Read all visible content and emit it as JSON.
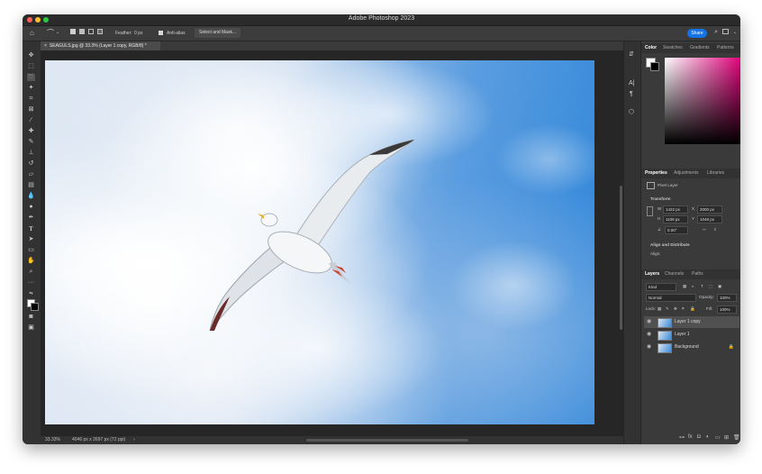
{
  "window": {
    "title": "Adobe Photoshop 2023",
    "traffic_colors": [
      "#ff5f57",
      "#febc2e",
      "#28c840"
    ]
  },
  "options_bar": {
    "feather_label": "Feather:",
    "feather_value": "0 px",
    "anti_alias_label": "Anti-alias",
    "select_mask_label": "Select and Mask...",
    "share_label": "Share"
  },
  "document": {
    "tab_title": "SEAGULS.jpg @ 33.3% (Layer 1 copy, RGB/8) *",
    "zoom": "33.33%",
    "dimensions": "4046 px x 2697 px (72 ppi)"
  },
  "color_panel": {
    "tabs": [
      "Color",
      "Swatches",
      "Gradients",
      "Patterns"
    ],
    "active_tab": "Color"
  },
  "properties_panel": {
    "tabs": [
      "Properties",
      "Adjustments",
      "Libraries"
    ],
    "layer_kind": "Pixel Layer",
    "transform_label": "Transform",
    "w_label": "W",
    "w_value": "1422 px",
    "x_label": "X",
    "x_value": "2000 px",
    "h_label": "H",
    "h_value": "1109 px",
    "y_label": "Y",
    "y_value": "1048 px",
    "angle_value": "0.00°",
    "align_label": "Align and Distribute",
    "align_sub": "Align:"
  },
  "layers_panel": {
    "tabs": [
      "Layers",
      "Channels",
      "Paths"
    ],
    "filter_kind": "Kind",
    "blend_mode": "Normal",
    "opacity_label": "Opacity:",
    "opacity_value": "100%",
    "lock_label": "Lock:",
    "fill_label": "Fill:",
    "fill_value": "100%",
    "layers": [
      {
        "name": "Layer 1 copy"
      },
      {
        "name": "Layer 1"
      },
      {
        "name": "Background"
      }
    ]
  },
  "accent_color": "#1473e6"
}
